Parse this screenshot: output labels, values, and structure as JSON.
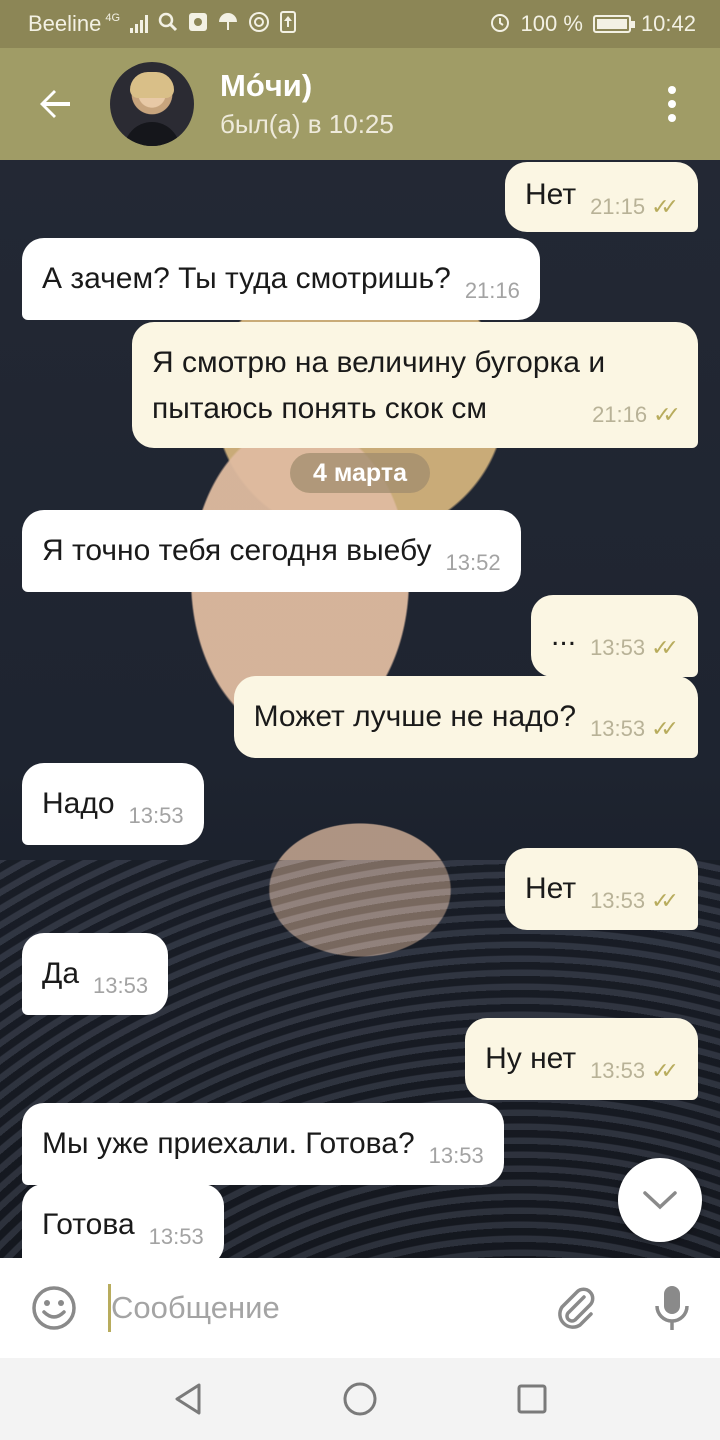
{
  "status_bar": {
    "carrier": "Beeline",
    "network": "4G",
    "battery": "100 %",
    "battery_level": 1.0,
    "time": "10:42",
    "icons": [
      "signal-icon",
      "search-icon",
      "image-icon",
      "umbrella-icon",
      "at-icon",
      "upload-icon",
      "alarm-icon",
      "battery-icon"
    ]
  },
  "header": {
    "back_icon": "arrow-back-icon",
    "contact_name": "Мо́чи)",
    "contact_status": "был(а) в 10:25",
    "menu_icon": "more-vertical-icon"
  },
  "messages": [
    {
      "dir": "out",
      "text": "Нет",
      "time": "21:15",
      "read": true
    },
    {
      "dir": "in",
      "text": "А зачем? Ты туда смотришь?",
      "time": "21:16"
    },
    {
      "dir": "out",
      "text": "Я смотрю на величину бугорка и пытаюсь понять скок см",
      "time": "21:16",
      "read": true
    },
    {
      "dir": "in",
      "text": "Я точно тебя сегодня выебу",
      "time": "13:52"
    },
    {
      "dir": "out",
      "text": "...",
      "time": "13:53",
      "read": true
    },
    {
      "dir": "out",
      "text": "Может лучше не надо?",
      "time": "13:53",
      "read": true
    },
    {
      "dir": "in",
      "text": "Надо",
      "time": "13:53"
    },
    {
      "dir": "out",
      "text": "Нет",
      "time": "13:53",
      "read": true
    },
    {
      "dir": "in",
      "text": "Да",
      "time": "13:53"
    },
    {
      "dir": "out",
      "text": "Ну нет",
      "time": "13:53",
      "read": true
    },
    {
      "dir": "in",
      "text": "Мы уже приехали. Готова?",
      "time": "13:53"
    },
    {
      "dir": "in",
      "text": "Готова",
      "time": "13:53"
    }
  ],
  "date_separator": "4 марта",
  "ticks_glyph": "✓✓",
  "composer": {
    "placeholder": "Сообщение",
    "value": "",
    "emoji_icon": "smile-icon",
    "attach_icon": "paperclip-icon",
    "mic_icon": "microphone-icon"
  },
  "scroll_down_icon": "chevron-down-icon",
  "nav": [
    "back-triangle-icon",
    "home-circle-icon",
    "recents-square-icon"
  ],
  "colors": {
    "status_bar": "#8c8656",
    "header": "#a09c66",
    "incoming_bubble": "#ffffff",
    "outgoing_bubble": "#fbf6e3",
    "read_ticks": "#b8ac5d",
    "caret": "#b8ac5d"
  }
}
